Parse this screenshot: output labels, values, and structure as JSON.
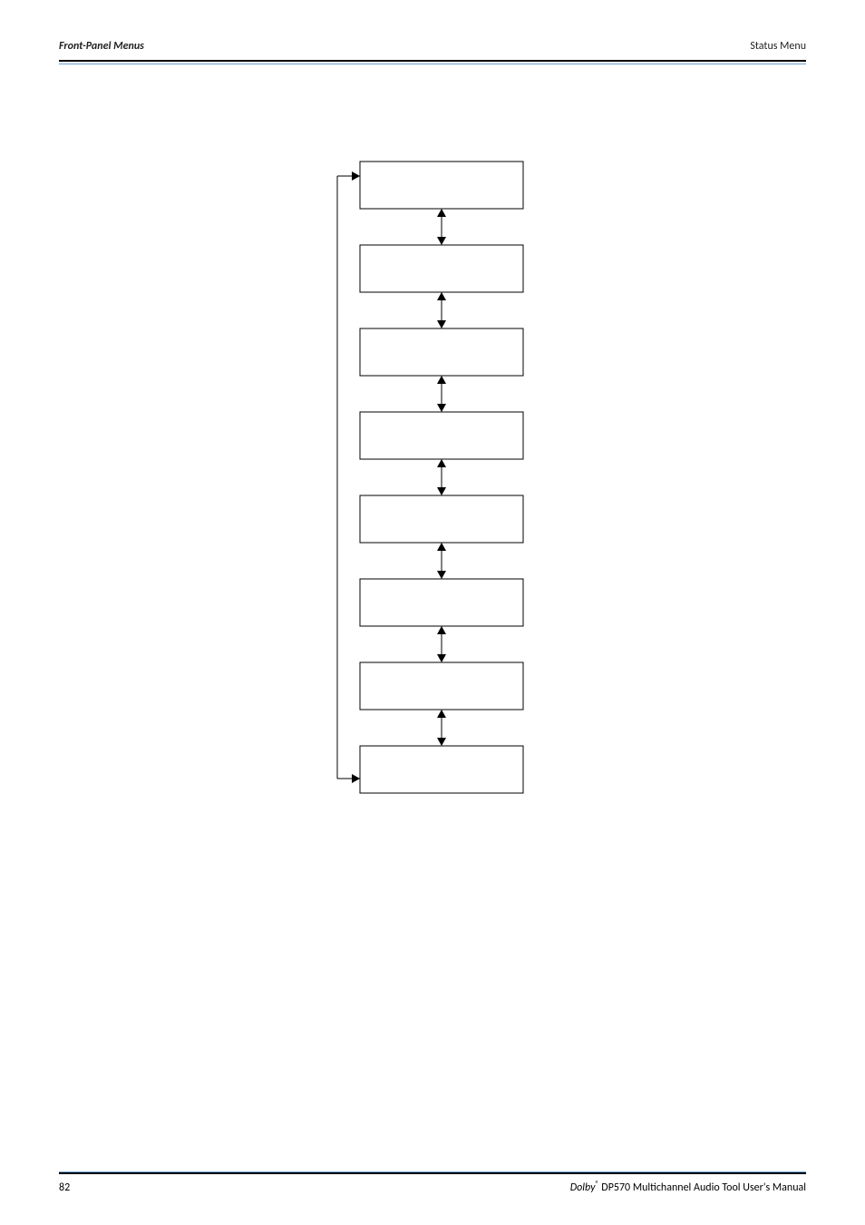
{
  "header": {
    "left": "Front-Panel Menus",
    "right": "Status Menu"
  },
  "footer": {
    "page": "82",
    "brand": "Dolby",
    "reg": "®",
    "title_rest": " DP570 Multichannel Audio Tool User's Manual"
  },
  "diagram": {
    "boxes": 8,
    "arrows_between": 7,
    "loop_back": true
  },
  "chart_data": {
    "type": "diagram",
    "description": "Vertical flow/menu chain of 8 empty boxes connected by bidirectional up/down arrows, with a wrap-around line on the left connecting the last box back to the first.",
    "nodes": [
      "",
      "",
      "",
      "",
      "",
      "",
      "",
      ""
    ],
    "arrow_style": "bidirectional-vertical",
    "wraps": true
  }
}
